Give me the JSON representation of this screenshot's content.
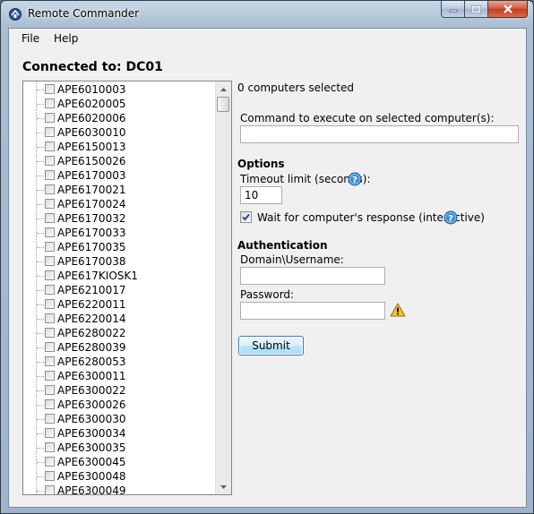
{
  "window": {
    "title": "Remote Commander",
    "icon": "remote-commander-app-icon"
  },
  "menu": {
    "file": "File",
    "help": "Help"
  },
  "connection": {
    "label": "Connected to: DC01"
  },
  "computers": [
    "APE6010003",
    "APE6020005",
    "APE6020006",
    "APE6030010",
    "APE6150013",
    "APE6150026",
    "APE6170003",
    "APE6170021",
    "APE6170024",
    "APE6170032",
    "APE6170033",
    "APE6170035",
    "APE6170038",
    "APE617KIOSK1",
    "APE6210017",
    "APE6220011",
    "APE6220014",
    "APE6280022",
    "APE6280039",
    "APE6280053",
    "APE6300011",
    "APE6300022",
    "APE6300026",
    "APE6300030",
    "APE6300034",
    "APE6300035",
    "APE6300045",
    "APE6300048",
    "APE6300049"
  ],
  "selection": {
    "status": "0 computers selected"
  },
  "command": {
    "label": "Command to execute on selected computer(s):",
    "value": ""
  },
  "options": {
    "heading": "Options",
    "timeout_label": "Timeout limit (seconds):",
    "timeout_value": "10",
    "wait_label": "Wait for computer's response (interactive)",
    "wait_checked": true
  },
  "auth": {
    "heading": "Authentication",
    "username_label": "Domain\\Username:",
    "username_value": "",
    "password_label": "Password:",
    "password_value": ""
  },
  "actions": {
    "submit": "Submit"
  },
  "colors": {
    "help_icon": "#3d8fd6",
    "warning_icon": "#f2c230",
    "submit_border": "#3c7fb1"
  }
}
